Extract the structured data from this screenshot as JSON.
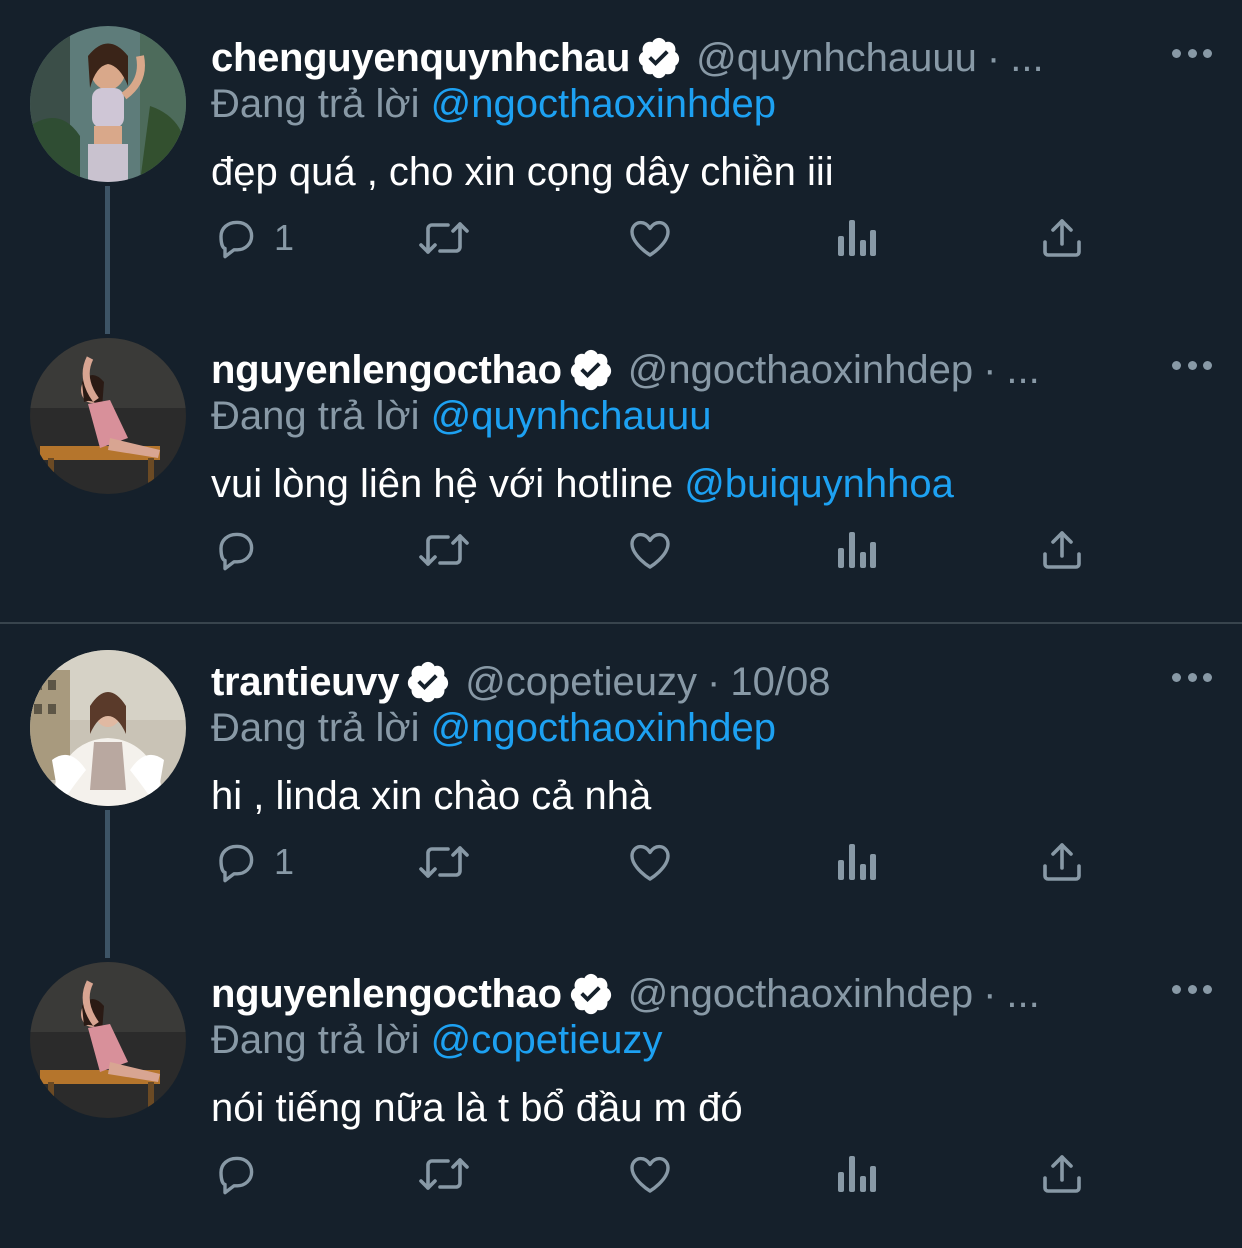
{
  "colors": {
    "background": "#15202b",
    "text_primary": "#ffffff",
    "text_secondary": "#8899a6",
    "link": "#1da1f2",
    "thread_line": "#3d5466"
  },
  "tweets": [
    {
      "display_name": "chenguyenquynhchau",
      "verified": true,
      "handle": "@quynhchauuu",
      "separator": "·",
      "time": "...",
      "reply_label": "Đang trả lời",
      "reply_to": "@ngocthaoxinhdep",
      "text": "đẹp quá , cho xin cọng dây chiền iii",
      "text_mention": "",
      "reply_count": "1",
      "icons": [
        "reply-icon",
        "retweet-icon",
        "like-icon",
        "analytics-icon",
        "share-icon"
      ]
    },
    {
      "display_name": "nguyenlengocthao",
      "verified": true,
      "handle": "@ngocthaoxinhdep",
      "separator": "·",
      "time": "...",
      "reply_label": "Đang trả lời",
      "reply_to": "@quynhchauuu",
      "text": "vui lòng liên hệ với hotline ",
      "text_mention": "@buiquynhhoa",
      "reply_count": "",
      "icons": [
        "reply-icon",
        "retweet-icon",
        "like-icon",
        "analytics-icon",
        "share-icon"
      ]
    },
    {
      "display_name": "trantieuvy",
      "verified": true,
      "handle": "@copetieuzy",
      "separator": "·",
      "time": "10/08",
      "reply_label": "Đang trả lời",
      "reply_to": "@ngocthaoxinhdep",
      "text": "hi , linda xin chào cả nhà",
      "text_mention": "",
      "reply_count": "1",
      "icons": [
        "reply-icon",
        "retweet-icon",
        "like-icon",
        "analytics-icon",
        "share-icon"
      ]
    },
    {
      "display_name": "nguyenlengocthao",
      "verified": true,
      "handle": "@ngocthaoxinhdep",
      "separator": "·",
      "time": "...",
      "reply_label": "Đang trả lời",
      "reply_to": "@copetieuzy",
      "text": "nói tiếng nữa là t bổ đầu m đó",
      "text_mention": "",
      "reply_count": "",
      "icons": [
        "reply-icon",
        "retweet-icon",
        "like-icon",
        "analytics-icon",
        "share-icon"
      ]
    }
  ]
}
